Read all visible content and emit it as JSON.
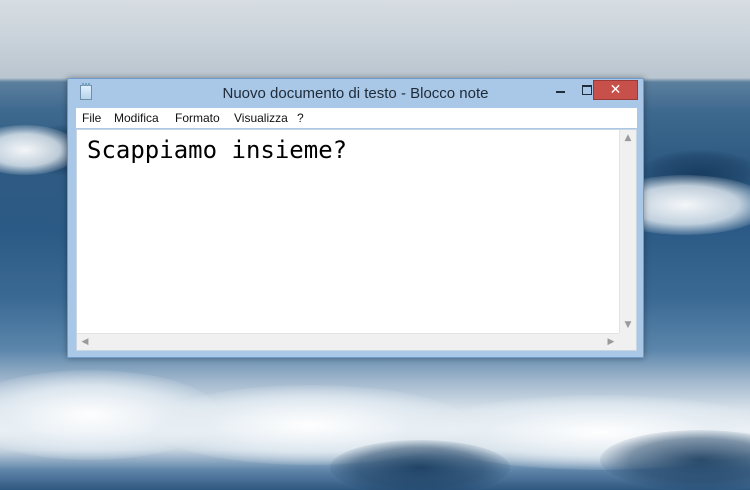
{
  "window": {
    "title": "Nuovo documento di testo - Blocco note",
    "app_icon": "notepad-icon",
    "controls": {
      "minimize_icon": "minimize-icon",
      "maximize_icon": "maximize-icon",
      "close_label": "✕"
    }
  },
  "menubar": {
    "items": [
      {
        "label": "File"
      },
      {
        "label": "Modifica"
      },
      {
        "label": "Formato"
      },
      {
        "label": "Visualizza"
      },
      {
        "label": "?"
      }
    ]
  },
  "editor": {
    "text": "Scappiamo insieme?"
  },
  "scrollbars": {
    "up_arrow": "▲",
    "down_arrow": "▼",
    "left_arrow": "◀",
    "right_arrow": "▶"
  },
  "colors": {
    "window_frame": "#a9c7e6",
    "close_button": "#c7504a"
  }
}
